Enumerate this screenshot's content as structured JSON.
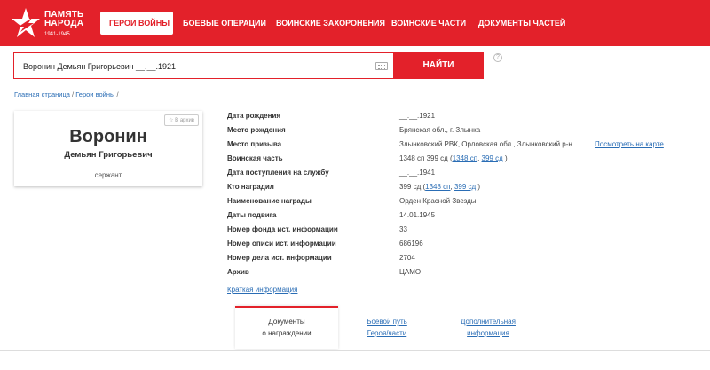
{
  "header": {
    "logo_line1": "ПАМЯТЬ",
    "logo_line2": "НАРОДА",
    "logo_years": "1941-1945",
    "nav": [
      {
        "label": "ГЕРОИ ВОЙНЫ",
        "active": true
      },
      {
        "label": "БОЕВЫЕ ОПЕРАЦИИ"
      },
      {
        "label": "ВОИНСКИЕ ЗАХОРОНЕНИЯ"
      },
      {
        "label": "ВОИНСКИЕ ЧАСТИ"
      },
      {
        "label": "ДОКУМЕНТЫ ЧАСТЕЙ"
      }
    ],
    "brand_color": "#e3212a"
  },
  "search": {
    "value": "Воронин Демьян Григорьевич __.__.1921",
    "button_label": "НАЙТИ",
    "help": "?"
  },
  "breadcrumb": {
    "home": "Главная страница",
    "sep": " / ",
    "section": "Герои войны",
    "tail": " /"
  },
  "card": {
    "archive_label": "☆ В архив",
    "surname": "Воронин",
    "name": "Демьян Григорьевич",
    "rank": "сержант"
  },
  "info": [
    {
      "label": "Дата рождения",
      "value": "__.__.1921"
    },
    {
      "label": "Место рождения",
      "value": "Брянская обл., г. Злынка"
    },
    {
      "label": "Место призыва",
      "value": "Злынковский РВК, Орловская обл., Злынковский р-н",
      "link": "Посмотреть на карте"
    },
    {
      "label": "Воинская часть",
      "prefix": "1348 сп 399 сд (",
      "links": [
        "1348 сп",
        "399 сд"
      ],
      "suffix": ")"
    },
    {
      "label": "Дата поступления на службу",
      "value": "__.__.1941"
    },
    {
      "label": "Кто наградил",
      "prefix": "399 сд (",
      "links": [
        "1348 сп",
        "399 сд"
      ],
      "suffix": ")"
    },
    {
      "label": "Наименование награды",
      "value": "Орден Красной Звезды"
    },
    {
      "label": "Даты подвига",
      "value": "14.01.1945"
    },
    {
      "label": "Номер фонда ист. информации",
      "value": "33"
    },
    {
      "label": "Номер описи ист. информации",
      "value": "686196"
    },
    {
      "label": "Номер дела ист. информации",
      "value": "2704"
    },
    {
      "label": "Архив",
      "value": "ЦАМО"
    }
  ],
  "brief_link": "Краткая информация",
  "tabs": [
    {
      "line1": "Документы",
      "line2": "о награждении",
      "active": true
    },
    {
      "line1": "Боевой путь",
      "line2": "Героя/части"
    },
    {
      "line1": "Дополнительная",
      "line2": "информация"
    }
  ],
  "icons": {
    "logo": "star-logo-icon",
    "keyboard": "keyboard-icon",
    "help": "help-icon",
    "archive": "star-icon"
  }
}
